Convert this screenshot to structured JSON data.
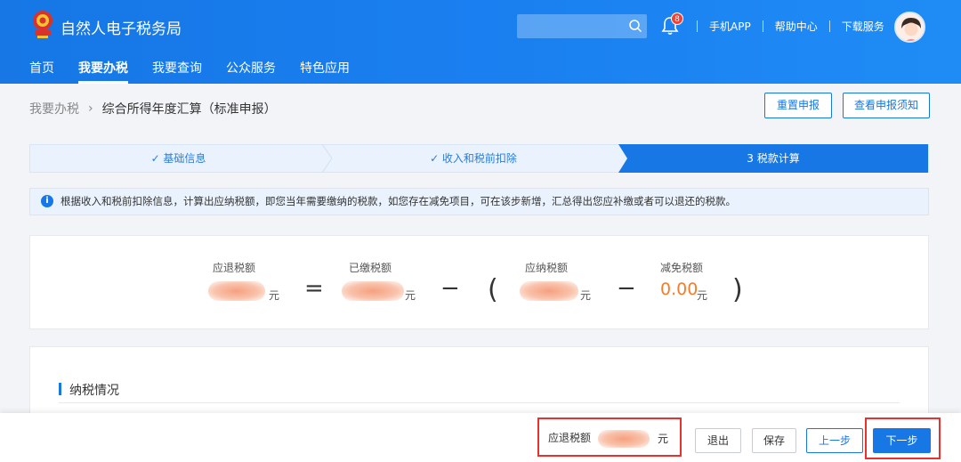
{
  "header": {
    "site_title": "自然人电子税务局",
    "notification_count": "8",
    "links": [
      "手机APP",
      "帮助中心",
      "下载服务"
    ]
  },
  "nav": [
    "首页",
    "我要办税",
    "我要查询",
    "公众服务",
    "特色应用"
  ],
  "breadcrumb": {
    "parent": "我要办税",
    "current": "综合所得年度汇算（标准申报）"
  },
  "actions": {
    "reset": "重置申报",
    "notice": "查看申报须知"
  },
  "steps": [
    {
      "label": "✓ 基础信息"
    },
    {
      "label": "✓ 收入和税前扣除"
    },
    {
      "label": "3 税款计算"
    }
  ],
  "info_text": "根据收入和税前扣除信息，计算出应纳税额，即您当年需要缴纳的税款，如您存在减免项目，可在该步新增，汇总得出您应补缴或者可以退还的税款。",
  "formula": {
    "refund_label": "应退税额",
    "paid_label": "已缴税额",
    "payable_label": "应纳税额",
    "relief_label": "减免税额",
    "relief_value": "0.00",
    "unit": "元",
    "equals": "=",
    "minus": "−",
    "open_paren": "(",
    "close_paren": ")"
  },
  "section": {
    "title": "纳税情况"
  },
  "footer": {
    "refund_label": "应退税额",
    "unit": "元",
    "exit": "退出",
    "save": "保存",
    "prev": "上一步",
    "next": "下一步"
  },
  "colors": {
    "primary": "#1677e5",
    "highlight": "#e8322d",
    "amount": "#f57d2a"
  }
}
